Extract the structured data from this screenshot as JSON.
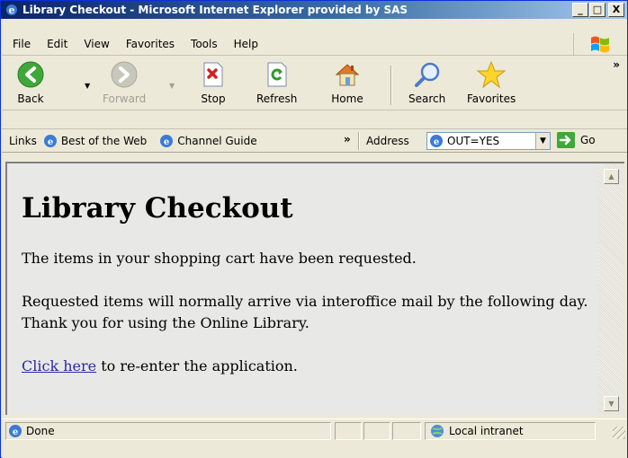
{
  "window": {
    "title": "Library Checkout - Microsoft Internet Explorer provided by SAS",
    "minimize": "_",
    "maximize": "□",
    "close": "X"
  },
  "menu": {
    "items": [
      "File",
      "Edit",
      "View",
      "Favorites",
      "Tools",
      "Help"
    ]
  },
  "toolbar": {
    "back": "Back",
    "forward": "Forward",
    "stop": "Stop",
    "refresh": "Refresh",
    "home": "Home",
    "search": "Search",
    "favorites": "Favorites",
    "more": "»"
  },
  "links_bar": {
    "label": "Links",
    "items": [
      "Best of the Web",
      "Channel Guide"
    ],
    "more": "»"
  },
  "address_bar": {
    "label": "Address",
    "value": "OUT=YES",
    "go": "Go"
  },
  "page": {
    "heading": "Library Checkout",
    "paragraph1": "The items in your shopping cart have been requested.",
    "paragraph2": "Requested items will normally arrive via interoffice mail by the following day. Thank you for using the Online Library.",
    "link_text": "Click here",
    "link_suffix": " to re-enter the application."
  },
  "status": {
    "text": "Done",
    "zone": "Local intranet"
  },
  "colors": {
    "title_bar": "#0a246a",
    "link": "#2a2aa6",
    "chrome": "#ece9d8"
  },
  "icons": {
    "back": "green-back-arrow-icon",
    "forward": "gray-forward-arrow-icon",
    "stop": "red-x-stop-icon",
    "refresh": "green-refresh-icon",
    "home": "house-icon",
    "search": "magnifier-icon",
    "favorites": "star-icon",
    "ie": "ie-logo-icon",
    "windows": "windows-flag-icon",
    "intranet": "globe-network-icon"
  }
}
